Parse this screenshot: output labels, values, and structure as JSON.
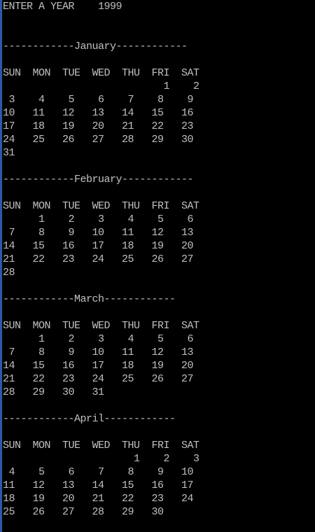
{
  "console": {
    "text_color": "#c0c0c0",
    "background_color": "#000000",
    "left_border_color": "#2a5aa8",
    "output": "ENTER A YEAR    1999\n\n\n------------January------------\n\nSUN  MON  TUE  WED  THU  FRI  SAT\n                           1    2\n 3    4    5    6    7    8    9\n10   11   12   13   14   15   16\n17   18   19   20   21   22   23\n24   25   26   27   28   29   30\n31\n\n------------February------------\n\nSUN  MON  TUE  WED  THU  FRI  SAT\n      1    2    3    4    5    6\n 7    8    9   10   11   12   13\n14   15   16   17   18   19   20\n21   22   23   24   25   26   27\n28\n\n------------March------------\n\nSUN  MON  TUE  WED  THU  FRI  SAT\n      1    2    3    4    5    6\n 7    8    9   10   11   12   13\n14   15   16   17   18   19   20\n21   22   23   24   25   26   27\n28   29   30   31\n\n------------April------------\n\nSUN  MON  TUE  WED  THU  FRI  SAT\n                      1    2    3\n 4    5    6    7    8    9   10\n11   12   13   14   15   16   17\n18   19   20   21   22   23   24\n25   26   27   28   29   30"
  }
}
